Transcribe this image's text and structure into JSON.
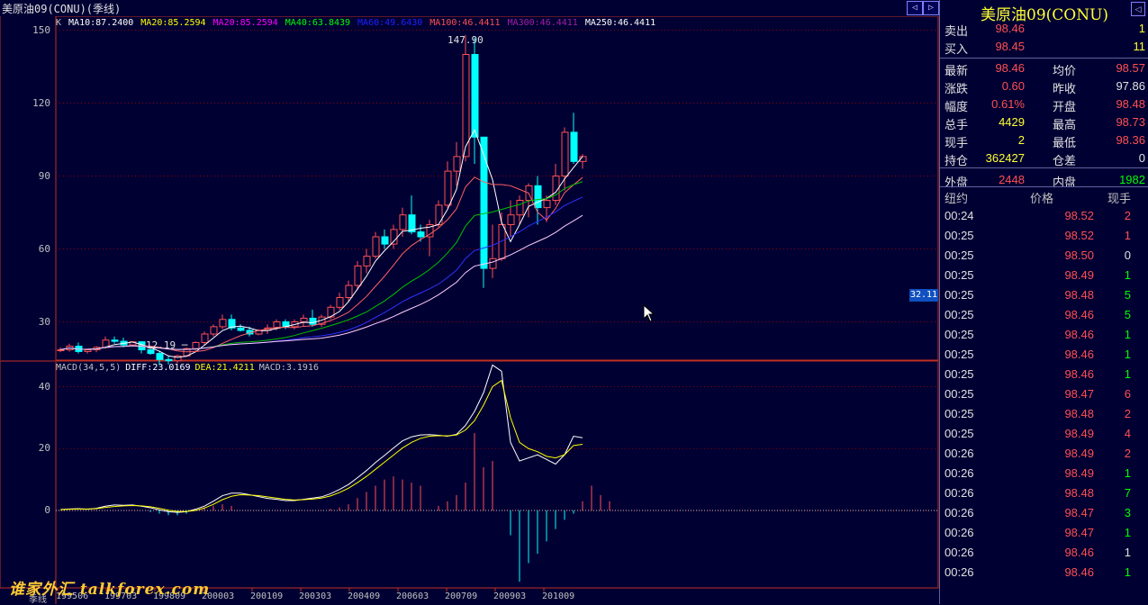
{
  "window": {
    "title": "美原油09(CONU)(季线)"
  },
  "nav": {
    "left": "◁",
    "right": "▷"
  },
  "colors": {
    "bg": "#000033",
    "up": "#ff5050",
    "down": "#00ffff",
    "grid": "#8b0000",
    "ma10": "#ffffff",
    "ma20": "#ffff00",
    "ma20b": "#ff00ff",
    "ma40": "#00ff00",
    "ma60": "#0000ff",
    "ma100": "#ff5050",
    "ma300": "#ff00ff",
    "ma250": "#ffffff"
  },
  "ma_legend": [
    {
      "text": "K",
      "color": "#c0c0c0"
    },
    {
      "text": "MA10:87.2400",
      "color": "#ffffff"
    },
    {
      "text": "MA20:85.2594",
      "color": "#ffff00"
    },
    {
      "text": "MA20:85.2594",
      "color": "#ff00ff"
    },
    {
      "text": "MA40:63.8439",
      "color": "#00ff00"
    },
    {
      "text": "MA60:49.6430",
      "color": "#2020ff"
    },
    {
      "text": "MA100:46.4411",
      "color": "#ff5050"
    },
    {
      "text": "MA300:46.4411",
      "color": "#a020a0"
    },
    {
      "text": "MA250:46.4411",
      "color": "#ffffff"
    }
  ],
  "macd_legend": [
    {
      "text": "MACD(34,5,5)",
      "color": "#c0c0c0"
    },
    {
      "text": "DIFF:23.0169",
      "color": "#ffffff"
    },
    {
      "text": "DEA:21.4211",
      "color": "#ffff00"
    },
    {
      "text": "MACD:3.1916",
      "color": "#c0c0c0"
    }
  ],
  "labels": {
    "high": "147.90",
    "low": "12.19",
    "price_tag": "32.11",
    "watermark": "谁家外汇 talkforex.com",
    "x_axis_title": "季线"
  },
  "chart_data": [
    {
      "type": "candlestick",
      "title": "美原油09(CONU)(季线)",
      "ylim": [
        15,
        155
      ],
      "yticks": [
        30,
        60,
        90,
        120,
        150
      ],
      "x_tick_labels": [
        "199506",
        "199703",
        "199809",
        "200003",
        "200109",
        "200303",
        "200409",
        "200603",
        "200709",
        "200903",
        "201009"
      ],
      "high_label": 147.9,
      "low_label": 12.19,
      "candles": [
        [
          18.5,
          19.5,
          17.5,
          18.5
        ],
        [
          18.5,
          21,
          17.8,
          20
        ],
        [
          20,
          21.5,
          17,
          17.8
        ],
        [
          17.8,
          19,
          17,
          18.5
        ],
        [
          18.5,
          20,
          17.5,
          19.5
        ],
        [
          19.5,
          24,
          19,
          22.5
        ],
        [
          22.5,
          24,
          21,
          22
        ],
        [
          22,
          23.5,
          19.5,
          20.5
        ],
        [
          20.5,
          22,
          20,
          21.8
        ],
        [
          21.8,
          22,
          17,
          18.5
        ],
        [
          18.5,
          20,
          16.5,
          17
        ],
        [
          17,
          18,
          12.19,
          14.5
        ],
        [
          14.5,
          16,
          12.5,
          14
        ],
        [
          14,
          16.5,
          13,
          16
        ],
        [
          16,
          19.5,
          15.5,
          19
        ],
        [
          19,
          22,
          18,
          21.5
        ],
        [
          21.5,
          26,
          20.5,
          25
        ],
        [
          25,
          29,
          24,
          28
        ],
        [
          28,
          33,
          27,
          31
        ],
        [
          31,
          33,
          26.5,
          27.5
        ],
        [
          27.5,
          29,
          26,
          26.5
        ],
        [
          26.5,
          28,
          24,
          25
        ],
        [
          25,
          27,
          24.5,
          26.5
        ],
        [
          26.5,
          29,
          25,
          27.5
        ],
        [
          27.5,
          31,
          26.5,
          30
        ],
        [
          30,
          31,
          27,
          28
        ],
        [
          28,
          31,
          27,
          30
        ],
        [
          30,
          33,
          28,
          31.5
        ],
        [
          31.5,
          35,
          28,
          29
        ],
        [
          29,
          33,
          28,
          32
        ],
        [
          32,
          37,
          31,
          36
        ],
        [
          36,
          42,
          35,
          40
        ],
        [
          40,
          47,
          38,
          45
        ],
        [
          45,
          55,
          43,
          53
        ],
        [
          53,
          60,
          50,
          57
        ],
        [
          57,
          67,
          56,
          65
        ],
        [
          65,
          68,
          60,
          62
        ],
        [
          62,
          70,
          60,
          68
        ],
        [
          68,
          77,
          65,
          74
        ],
        [
          74,
          82,
          66,
          67
        ],
        [
          67,
          70,
          63,
          65
        ],
        [
          65,
          72,
          57,
          70
        ],
        [
          70,
          80,
          69,
          78
        ],
        [
          78,
          96,
          77,
          92
        ],
        [
          92,
          104,
          86,
          98
        ],
        [
          98,
          147.9,
          96,
          140
        ],
        [
          140,
          147,
          95,
          106
        ],
        [
          106,
          100,
          44,
          52
        ],
        [
          52,
          70,
          48,
          56
        ],
        [
          56,
          75,
          55,
          70
        ],
        [
          70,
          80,
          65,
          74
        ],
        [
          74,
          82,
          70,
          80
        ],
        [
          80,
          87,
          73,
          86
        ],
        [
          86,
          90,
          70,
          77
        ],
        [
          77,
          82,
          71,
          80
        ],
        [
          80,
          95,
          78,
          90
        ],
        [
          90,
          110,
          84,
          108
        ],
        [
          108,
          116,
          95,
          96
        ],
        [
          96,
          99,
          93,
          98
        ]
      ]
    },
    {
      "type": "line",
      "title": "MACD(34,5,5)",
      "ylim": [
        -25,
        48
      ],
      "yticks": [
        0,
        20,
        40
      ],
      "diff": [
        0.3,
        0.5,
        0.6,
        0.4,
        0.7,
        1.4,
        1.8,
        1.7,
        1.8,
        1.4,
        0.9,
        0.2,
        -0.4,
        -0.6,
        -0.4,
        0.4,
        1.4,
        3.0,
        4.8,
        5.6,
        5.6,
        5.1,
        4.5,
        3.9,
        3.6,
        3.2,
        3.2,
        3.6,
        4.0,
        4.4,
        5.4,
        6.8,
        8.4,
        10.6,
        12.9,
        15.5,
        17.8,
        20.2,
        22.5,
        23.8,
        24.4,
        24.5,
        24.3,
        24.0,
        24.6,
        27.5,
        32.0,
        38.0,
        47.0,
        45.0,
        22.0,
        16.0,
        17.0,
        18.0,
        16.5,
        15.0,
        18.0,
        24.0,
        23.5
      ],
      "dea": [
        0.3,
        0.4,
        0.5,
        0.5,
        0.6,
        1.0,
        1.3,
        1.5,
        1.6,
        1.5,
        1.2,
        0.7,
        0.1,
        -0.3,
        -0.3,
        0.0,
        0.8,
        2.0,
        3.5,
        4.6,
        5.1,
        5.0,
        4.8,
        4.4,
        4.0,
        3.6,
        3.4,
        3.5,
        3.7,
        4.0,
        4.7,
        5.8,
        7.2,
        9.0,
        11.0,
        13.3,
        15.6,
        17.9,
        20.2,
        22.0,
        23.3,
        24.0,
        24.2,
        24.1,
        24.4,
        26.0,
        29.0,
        34.0,
        40.0,
        42.0,
        30.0,
        22.0,
        20.0,
        19.0,
        17.5,
        17.0,
        18.0,
        21.0,
        21.4
      ],
      "macd": [
        0.0,
        0.1,
        0.1,
        -0.1,
        0.1,
        0.4,
        0.5,
        0.2,
        0.2,
        -0.1,
        -0.3,
        -0.5,
        -0.5,
        -0.3,
        -0.1,
        0.4,
        0.6,
        1.0,
        1.3,
        1.0,
        0.5,
        0.1,
        -0.3,
        -0.5,
        -0.4,
        -0.4,
        -0.2,
        0.1,
        0.3,
        0.4,
        0.7,
        1.0,
        1.2,
        1.6,
        1.9,
        2.2,
        2.2,
        2.3,
        2.3,
        1.8,
        1.1,
        0.5,
        0.1,
        -0.1,
        0.2,
        1.5,
        3.0,
        4.0,
        7.0,
        3.0,
        -8.0,
        -6.0,
        -3.0,
        -1.0,
        -1.0,
        -2.0,
        0.0,
        3.0,
        2.1
      ],
      "macd_bars": [
        [
          42,
          1.5
        ],
        [
          43,
          3
        ],
        [
          44,
          5
        ],
        [
          45,
          9
        ],
        [
          46,
          25
        ],
        [
          47,
          14
        ],
        [
          48,
          16
        ],
        [
          50,
          -8
        ],
        [
          51,
          -23
        ],
        [
          52,
          -17
        ],
        [
          53,
          -14
        ],
        [
          54,
          -10
        ],
        [
          55,
          -6
        ],
        [
          56,
          -3
        ],
        [
          57,
          -1
        ],
        [
          58,
          3
        ],
        [
          59,
          8
        ],
        [
          60,
          5
        ],
        [
          61,
          3
        ],
        [
          30,
          0.5
        ],
        [
          31,
          1
        ],
        [
          32,
          2
        ],
        [
          33,
          4
        ],
        [
          34,
          6
        ],
        [
          35,
          8
        ],
        [
          36,
          10
        ],
        [
          37,
          11
        ],
        [
          38,
          10
        ],
        [
          39,
          9
        ],
        [
          40,
          8
        ],
        [
          10,
          -0.5
        ],
        [
          11,
          -1
        ],
        [
          12,
          -1.5
        ],
        [
          13,
          -1.5
        ],
        [
          14,
          -1
        ],
        [
          15,
          0.5
        ],
        [
          16,
          1
        ],
        [
          17,
          1.5
        ],
        [
          18,
          2
        ],
        [
          19,
          1.5
        ]
      ]
    }
  ],
  "quote": {
    "name": "美原油09(CONU)",
    "rows": [
      {
        "a": "卖出",
        "b": "98.46",
        "bc": "#ff5050",
        "c": "",
        "d": "1",
        "dc": "#ffff33"
      },
      {
        "a": "买入",
        "b": "98.45",
        "bc": "#ff5050",
        "c": "",
        "d": "11",
        "dc": "#ffff33"
      },
      {
        "a": "最新",
        "b": "98.46",
        "bc": "#ff5050",
        "c": "均价",
        "d": "98.57",
        "dc": "#ff5050"
      },
      {
        "a": "涨跌",
        "b": "0.60",
        "bc": "#ff5050",
        "c": "昨收",
        "d": "97.86",
        "dc": "#e0e0e0"
      },
      {
        "a": "幅度",
        "b": "0.61%",
        "bc": "#ff5050",
        "c": "开盘",
        "d": "98.48",
        "dc": "#ff5050"
      },
      {
        "a": "总手",
        "b": "4429",
        "bc": "#ffff33",
        "c": "最高",
        "d": "98.73",
        "dc": "#ff5050"
      },
      {
        "a": "现手",
        "b": "2",
        "bc": "#ffff33",
        "c": "最低",
        "d": "98.36",
        "dc": "#ff5050"
      },
      {
        "a": "持仓",
        "b": "362427",
        "bc": "#ffff33",
        "c": "仓差",
        "d": "0",
        "dc": "#e0e0e0"
      },
      {
        "a": "外盘",
        "b": "2448",
        "bc": "#ff5050",
        "c": "内盘",
        "d": "1982",
        "dc": "#00ff00"
      }
    ],
    "tick_head": {
      "t": "纽约",
      "p": "价格",
      "v": "现手"
    },
    "ticks": [
      {
        "t": "00:24",
        "p": "98.52",
        "v": "2",
        "vc": "#ff5050"
      },
      {
        "t": "00:25",
        "p": "98.52",
        "v": "1",
        "vc": "#ff5050"
      },
      {
        "t": "00:25",
        "p": "98.50",
        "v": "0",
        "vc": "#e0e0e0"
      },
      {
        "t": "00:25",
        "p": "98.49",
        "v": "1",
        "vc": "#00ff00"
      },
      {
        "t": "00:25",
        "p": "98.48",
        "v": "5",
        "vc": "#00ff00"
      },
      {
        "t": "00:25",
        "p": "98.46",
        "v": "5",
        "vc": "#00ff00"
      },
      {
        "t": "00:25",
        "p": "98.46",
        "v": "1",
        "vc": "#00ff00"
      },
      {
        "t": "00:25",
        "p": "98.46",
        "v": "1",
        "vc": "#00ff00"
      },
      {
        "t": "00:25",
        "p": "98.46",
        "v": "1",
        "vc": "#00ff00"
      },
      {
        "t": "00:25",
        "p": "98.47",
        "v": "6",
        "vc": "#ff5050"
      },
      {
        "t": "00:25",
        "p": "98.48",
        "v": "2",
        "vc": "#ff5050"
      },
      {
        "t": "00:25",
        "p": "98.49",
        "v": "4",
        "vc": "#ff5050"
      },
      {
        "t": "00:26",
        "p": "98.49",
        "v": "2",
        "vc": "#ff5050"
      },
      {
        "t": "00:26",
        "p": "98.49",
        "v": "1",
        "vc": "#00ff00"
      },
      {
        "t": "00:26",
        "p": "98.48",
        "v": "7",
        "vc": "#00ff00"
      },
      {
        "t": "00:26",
        "p": "98.47",
        "v": "3",
        "vc": "#00ff00"
      },
      {
        "t": "00:26",
        "p": "98.47",
        "v": "1",
        "vc": "#00ff00"
      },
      {
        "t": "00:26",
        "p": "98.46",
        "v": "1",
        "vc": "#e0e0e0"
      },
      {
        "t": "00:26",
        "p": "98.46",
        "v": "1",
        "vc": "#00ff00"
      }
    ]
  }
}
